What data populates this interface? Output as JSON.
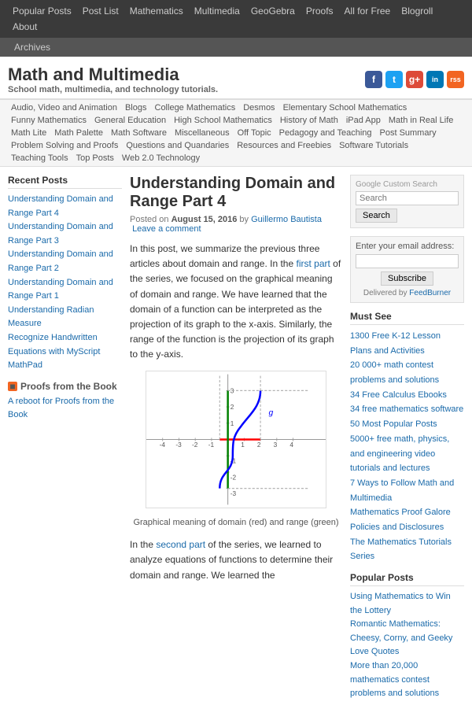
{
  "topnav": {
    "items": [
      {
        "label": "Popular Posts",
        "href": "#"
      },
      {
        "label": "Post List",
        "href": "#"
      },
      {
        "label": "Mathematics",
        "href": "#"
      },
      {
        "label": "Multimedia",
        "href": "#"
      },
      {
        "label": "GeoGebra",
        "href": "#"
      },
      {
        "label": "Proofs",
        "href": "#"
      },
      {
        "label": "All for Free",
        "href": "#"
      },
      {
        "label": "Blogroll",
        "href": "#"
      },
      {
        "label": "About",
        "href": "#"
      }
    ],
    "second": [
      {
        "label": "Archives",
        "href": "#"
      }
    ]
  },
  "site": {
    "title": "Math and Multimedia",
    "tagline": "School math, multimedia, and technology tutorials."
  },
  "social": [
    {
      "name": "Facebook",
      "letter": "f",
      "class": "fb"
    },
    {
      "name": "Twitter",
      "letter": "t",
      "class": "tw"
    },
    {
      "name": "Google+",
      "letter": "g+",
      "class": "gp"
    },
    {
      "name": "LinkedIn",
      "letter": "in",
      "class": "li"
    },
    {
      "name": "RSS",
      "letter": "rss",
      "class": "rss"
    }
  ],
  "catnav": {
    "rows": [
      [
        "Audio, Video and Animation",
        "Blogs",
        "College Mathematics",
        "Desmos",
        "Elementary School Mathematics",
        "Funny Mathematics"
      ],
      [
        "General Education",
        "High School Mathematics",
        "History of Math",
        "iPad App",
        "Math in Real Life",
        "Math Lite",
        "Math Palette",
        "Math Software"
      ],
      [
        "Miscellaneous",
        "Off Topic",
        "Pedagogy and Teaching",
        "Post Summary",
        "Problem Solving and Proofs",
        "Questions and Quandaries"
      ],
      [
        "Resources and Freebies",
        "Software Tutorials",
        "Teaching Tools",
        "Top Posts",
        "Web 2.0 Technology"
      ]
    ]
  },
  "sidebar_left": {
    "recent_posts_heading": "Recent Posts",
    "recent_posts": [
      {
        "label": "Understanding Domain and Range Part 4",
        "href": "#"
      },
      {
        "label": "Understanding Domain and Range Part 3",
        "href": "#"
      },
      {
        "label": "Understanding Domain and Range Part 2",
        "href": "#"
      },
      {
        "label": "Understanding Domain and Range Part 1",
        "href": "#"
      },
      {
        "label": "Understanding Radian Measure",
        "href": "#"
      },
      {
        "label": "Recognize Handwritten Equations with MyScript MathPad",
        "href": "#"
      }
    ],
    "proofs_heading": "Proofs from the Book",
    "proofs": [
      {
        "label": "A reboot for Proofs from the Book",
        "href": "#"
      }
    ]
  },
  "post": {
    "title": "Understanding Domain and Range Part 4",
    "date": "August 15, 2016",
    "author": "Guillermo Bautista",
    "comment_link": "Leave a comment",
    "body_p1": "In this post, we summarize the previous three articles about domain and range. In the ",
    "first_part_link": "first part",
    "body_p1b": " of the series, we focused on the graphical meaning of domain and range. We have learned that the domain of a function can be interpreted as the projection of its graph to the x-axis. Similarly, the range of the function is the projection of its graph to the y-axis.",
    "graph_caption": "Graphical meaning of domain (red) and range (green)",
    "body_p2": "In the ",
    "second_part_link": "second part",
    "body_p2b": " of the series, we learned to analyze equations of functions to determine their domain and range. We learned the"
  },
  "sidebar_right": {
    "search_label": "Google Custom Search",
    "search_placeholder": "Search",
    "search_button": "Search",
    "email_prompt": "Enter your email address:",
    "email_placeholder": "",
    "subscribe_btn": "Subscribe",
    "feedburner_text": "Delivered by",
    "feedburner_link": "FeedBurner",
    "must_see_heading": "Must See",
    "must_see_links": [
      {
        "label": "1300 Free K-12 Lesson Plans and Activities",
        "href": "#"
      },
      {
        "label": "20 000+ math contest problems and solutions",
        "href": "#"
      },
      {
        "label": "34 Free Calculus Ebooks",
        "href": "#"
      },
      {
        "label": "34 free mathematics software",
        "href": "#"
      },
      {
        "label": "50 Most Popular Posts",
        "href": "#"
      },
      {
        "label": "5000+ free math, physics, and engineering video tutorials and lectures",
        "href": "#"
      },
      {
        "label": "7 Ways to Follow Math and Multimedia",
        "href": "#"
      },
      {
        "label": "Mathematics Proof Galore",
        "href": "#"
      },
      {
        "label": "Policies and Disclosures",
        "href": "#"
      },
      {
        "label": "The Mathematics Tutorials Series",
        "href": "#"
      }
    ],
    "popular_heading": "Popular Posts",
    "popular_links": [
      {
        "label": "Using Mathematics to Win the Lottery",
        "href": "#"
      },
      {
        "label": "Romantic Mathematics: Cheesy, Corny, and Geeky Love Quotes",
        "href": "#"
      },
      {
        "label": "More than 20,000 mathematics contest problems and solutions",
        "href": "#"
      }
    ]
  }
}
